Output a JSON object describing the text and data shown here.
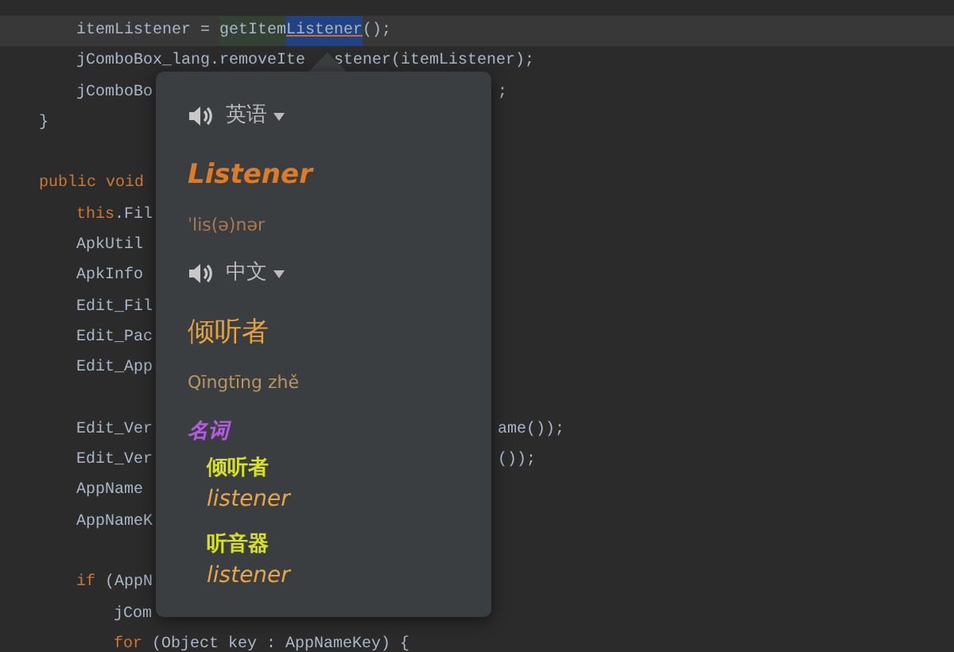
{
  "code": [
    {
      "children": [
        {
          "current": true,
          "tokens": [
            {
              "text": "itemListener = ",
              "kind": "plain"
            },
            {
              "text": "getItem",
              "kind": "match"
            },
            {
              "text": "Listener",
              "kind": "selected"
            },
            {
              "text": "();",
              "kind": "plain"
            }
          ]
        },
        {
          "current": false,
          "tokens": [
            {
              "text": "jComboBox_lang.removeIte",
              "kind": "plain"
            }
          ],
          "tail": {
            "text": "stener(itemListener);",
            "kind": "after-arrow"
          }
        },
        {
          "current": false,
          "tokens": [
            {
              "text": "jComboBo",
              "kind": "plain"
            }
          ],
          "tail": {
            "text": ";",
            "kind": "after-popup"
          }
        }
      ]
    },
    {
      "current": false,
      "tokens": [
        {
          "text": "}",
          "kind": "plain"
        }
      ]
    },
    {
      "kind": "blank"
    },
    {
      "current": false,
      "tokens": [
        {
          "text": "public void",
          "kind": "keyword"
        }
      ],
      "children": [
        {
          "current": false,
          "tokens": [
            {
              "text": "this",
              "kind": "keyword"
            },
            {
              "text": ".Fil",
              "kind": "plain"
            }
          ]
        },
        {
          "current": false,
          "tokens": [
            {
              "text": "ApkUtil",
              "kind": "plain"
            }
          ]
        },
        {
          "current": false,
          "tokens": [
            {
              "text": "ApkInfo",
              "kind": "plain"
            }
          ]
        },
        {
          "current": false,
          "tokens": [
            {
              "text": "Edit_Fil",
              "kind": "plain"
            }
          ]
        },
        {
          "current": false,
          "tokens": [
            {
              "text": "Edit_Pac",
              "kind": "plain"
            }
          ]
        },
        {
          "current": false,
          "tokens": [
            {
              "text": "Edit_App",
              "kind": "plain"
            }
          ]
        },
        {
          "kind": "blank"
        },
        {
          "current": false,
          "tokens": [
            {
              "text": "Edit_Ver",
              "kind": "plain"
            }
          ],
          "tail": {
            "text": "ame());",
            "kind": "after-popup"
          }
        },
        {
          "current": false,
          "tokens": [
            {
              "text": "Edit_Ver",
              "kind": "plain"
            }
          ],
          "tail": {
            "text": "());",
            "kind": "after-popup"
          }
        },
        {
          "current": false,
          "tokens": [
            {
              "text": "AppName",
              "kind": "plain"
            }
          ]
        },
        {
          "current": false,
          "tokens": [
            {
              "text": "AppNameK",
              "kind": "plain"
            }
          ]
        },
        {
          "kind": "blank"
        },
        {
          "current": false,
          "tokens": [
            {
              "text": "if",
              "kind": "keyword"
            },
            {
              "text": " (AppN",
              "kind": "plain"
            }
          ],
          "children": [
            {
              "current": false,
              "tokens": [
                {
                  "text": "jCom",
                  "kind": "plain"
                }
              ]
            },
            {
              "current": false,
              "tokens": [
                {
                  "text": "for",
                  "kind": "keyword"
                },
                {
                  "text": " (Object key : AppNameKey) {",
                  "kind": "plain"
                }
              ]
            }
          ]
        }
      ]
    }
  ],
  "popup": {
    "sections": [
      {
        "kind": "source",
        "language": "英语",
        "word": "Listener",
        "phonetic": "ˈlis(ə)nər"
      },
      {
        "kind": "target",
        "language": "中文",
        "word": "倾听者",
        "phonetic": "Qīngtīng zhě"
      }
    ],
    "definitions": [
      {
        "part_of_speech": "名词",
        "entries": [
          {
            "term": "倾听者",
            "gloss": "listener"
          },
          {
            "term": "听音器",
            "gloss": "listener"
          }
        ]
      }
    ]
  }
}
